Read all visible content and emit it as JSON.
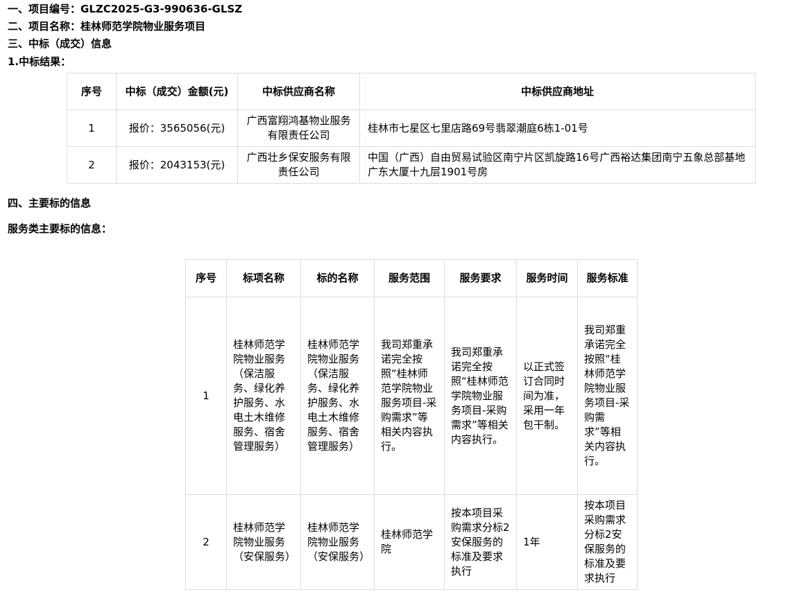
{
  "headings": {
    "project_no": "一、项目编号：GLZC2025-G3-990636-GLSZ",
    "project_name": "二、项目名称：桂林师范学院物业服务项目",
    "award_info": "三、中标（成交）信息",
    "result": "1.中标结果：",
    "main_subject": "四、主要标的信息",
    "service_subject": "服务类主要标的信息："
  },
  "award_table": {
    "headers": [
      "序号",
      "中标（成交）金额(元)",
      "中标供应商名称",
      "中标供应商地址"
    ],
    "rows": [
      {
        "no": "1",
        "amount": "报价：3565056(元)",
        "supplier": "广西富翔鸿基物业服务有限责任公司",
        "address": "桂林市七星区七里店路69号翡翠潮庭6栋1-01号"
      },
      {
        "no": "2",
        "amount": "报价：2043153(元)",
        "supplier": "广西壮乡保安服务有限责任公司",
        "address": "中国（广西）自由贸易试验区南宁片区凯旋路16号广西裕达集团南宁五象总部基地广东大厦十九层1901号房"
      }
    ]
  },
  "service_table": {
    "headers": [
      "序号",
      "标项名称",
      "标的名称",
      "服务范围",
      "服务要求",
      "服务时间",
      "服务标准"
    ],
    "rows": [
      {
        "no": "1",
        "item_name": "桂林师范学院物业服务（保洁服务、绿化养护服务、水电土木维修服务、宿舍管理服务）",
        "subject_name": "桂林师范学院物业服务（保洁服务、绿化养护服务、水电土木维修服务、宿舍管理服务）",
        "scope": "我司郑重承诺完全按照“桂林师范学院物业服务项目-采购需求”等相关内容执行。",
        "requirement": "我司郑重承诺完全按照“桂林师范学院物业服务项目-采购需求”等相关内容执行。",
        "time": "以正式签订合同时间为准，采用一年包干制。",
        "standard": "我司郑重承诺完全按照“桂林师范学院物业服务项目-采购需求”等相关内容执行。"
      },
      {
        "no": "2",
        "item_name": "桂林师范学院物业服务（安保服务）",
        "subject_name": "桂林师范学院物业服务（安保服务）",
        "scope": "桂林师范学院",
        "requirement": "按本项目采购需求分标2安保服务的标准及要求执行",
        "time": "1年",
        "standard": "按本项目采购需求分标2安保服务的标准及要求执行"
      }
    ]
  }
}
